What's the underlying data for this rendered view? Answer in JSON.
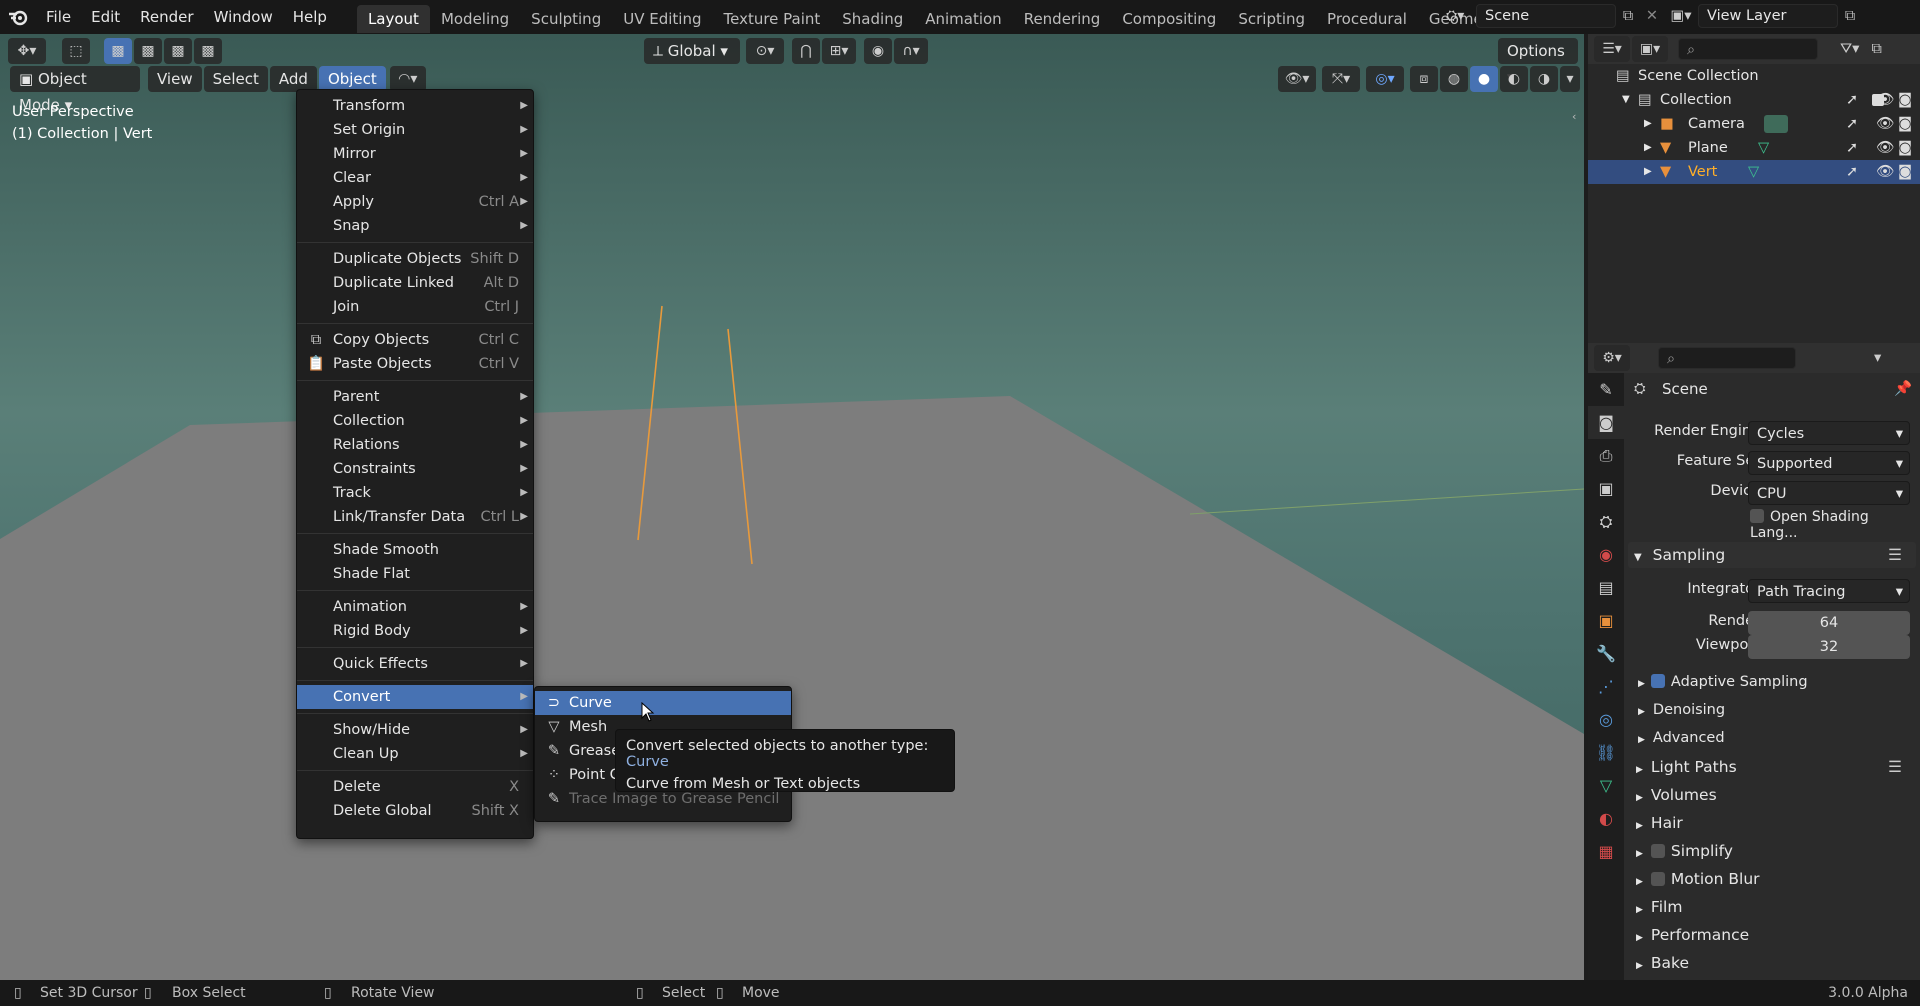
{
  "topbar": {
    "menus": [
      "File",
      "Edit",
      "Render",
      "Window",
      "Help"
    ],
    "workspaces": [
      "Layout",
      "Modeling",
      "Sculpting",
      "UV Editing",
      "Texture Paint",
      "Shading",
      "Animation",
      "Rendering",
      "Compositing",
      "Scripting",
      "Procedural",
      "Geometry Nodes"
    ],
    "active_workspace": "Layout",
    "scene": "Scene",
    "view_layer": "View Layer"
  },
  "viewport_toolbar": {
    "transform_orientation": "Global",
    "options_label": "Options"
  },
  "viewport_header": {
    "mode": "Object Mode",
    "menus": [
      "View",
      "Select",
      "Add",
      "Object"
    ],
    "active_menu": "Object"
  },
  "viewport_overlay": {
    "perspective": "User Perspective",
    "collection_info": "(1) Collection | Vert"
  },
  "object_menu": {
    "groups": [
      [
        {
          "label": "Transform",
          "submenu": true
        },
        {
          "label": "Set Origin",
          "submenu": true
        },
        {
          "label": "Mirror",
          "submenu": true
        },
        {
          "label": "Clear",
          "submenu": true
        },
        {
          "label": "Apply",
          "shortcut": "Ctrl A",
          "submenu": true
        },
        {
          "label": "Snap",
          "submenu": true
        }
      ],
      [
        {
          "label": "Duplicate Objects",
          "shortcut": "Shift D"
        },
        {
          "label": "Duplicate Linked",
          "shortcut": "Alt D"
        },
        {
          "label": "Join",
          "shortcut": "Ctrl J"
        }
      ],
      [
        {
          "label": "Copy Objects",
          "shortcut": "Ctrl C",
          "icon": "copy-icon"
        },
        {
          "label": "Paste Objects",
          "shortcut": "Ctrl V",
          "icon": "paste-icon"
        }
      ],
      [
        {
          "label": "Parent",
          "submenu": true
        },
        {
          "label": "Collection",
          "submenu": true
        },
        {
          "label": "Relations",
          "submenu": true
        },
        {
          "label": "Constraints",
          "submenu": true
        },
        {
          "label": "Track",
          "submenu": true
        },
        {
          "label": "Link/Transfer Data",
          "shortcut": "Ctrl L",
          "submenu": true
        }
      ],
      [
        {
          "label": "Shade Smooth"
        },
        {
          "label": "Shade Flat"
        }
      ],
      [
        {
          "label": "Animation",
          "submenu": true
        },
        {
          "label": "Rigid Body",
          "submenu": true
        }
      ],
      [
        {
          "label": "Quick Effects",
          "submenu": true
        }
      ],
      [
        {
          "label": "Convert",
          "submenu": true,
          "highlighted": true
        }
      ],
      [
        {
          "label": "Show/Hide",
          "submenu": true
        },
        {
          "label": "Clean Up",
          "submenu": true
        }
      ],
      [
        {
          "label": "Delete",
          "shortcut": "X"
        },
        {
          "label": "Delete Global",
          "shortcut": "Shift X"
        }
      ]
    ]
  },
  "convert_submenu": {
    "items": [
      {
        "label": "Curve",
        "icon": "curve-icon",
        "highlighted": true
      },
      {
        "label": "Mesh",
        "icon": "mesh-icon"
      },
      {
        "label": "Grease",
        "icon": "grease-pencil-icon"
      },
      {
        "label": "Point C",
        "icon": "point-cloud-icon"
      },
      {
        "label": "Trace Image to Grease Pencil",
        "icon": "trace-icon",
        "disabled": true
      }
    ]
  },
  "tooltip": {
    "title": "Convert selected objects to another type:",
    "value": "Curve",
    "description": "Curve from Mesh or Text objects"
  },
  "outliner": {
    "rows": [
      {
        "label": "Scene Collection",
        "level": 0
      },
      {
        "label": "Collection",
        "level": 1
      },
      {
        "label": "Camera",
        "level": 2
      },
      {
        "label": "Plane",
        "level": 2
      },
      {
        "label": "Vert",
        "level": 2,
        "selected": true
      }
    ]
  },
  "properties": {
    "header": "Scene",
    "render_engine_label": "Render Engine",
    "render_engine": "Cycles",
    "feature_set_label": "Feature Set",
    "feature_set": "Supported",
    "device_label": "Device",
    "device": "CPU",
    "osl_label": "Open Shading Lang...",
    "sampling": {
      "title": "Sampling",
      "integrator_label": "Integrator",
      "integrator": "Path Tracing",
      "render_label": "Render",
      "render_value": "64",
      "viewport_label": "Viewport",
      "viewport_value": "32",
      "adaptive_sampling": "Adaptive Sampling",
      "denoising": "Denoising",
      "advanced": "Advanced"
    },
    "panels": [
      "Light Paths",
      "Volumes",
      "Hair",
      "Simplify",
      "Motion Blur",
      "Film",
      "Performance",
      "Bake"
    ]
  },
  "statusbar": {
    "set_cursor": "Set 3D Cursor",
    "box_select": "Box Select",
    "rotate_view": "Rotate View",
    "select": "Select",
    "move": "Move",
    "version": "3.0.0 Alpha"
  },
  "colors": {
    "accent": "#4772b3",
    "selected_row": "#334d80",
    "orange_edge": "#e89a3c"
  }
}
